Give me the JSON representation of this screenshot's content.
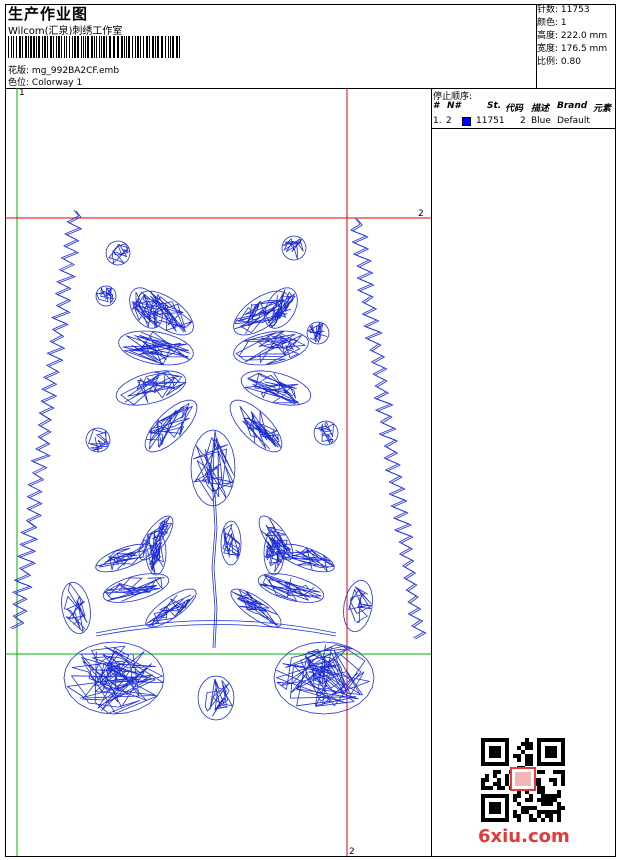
{
  "header": {
    "title": "生产作业图",
    "company": "Wilcom(汇泉)刺绣工作室",
    "design_label": "花版:",
    "design_value": "mg_992BA2CF.emb",
    "colorway_label": "色位:",
    "colorway_value": "Colorway 1"
  },
  "stats": [
    {
      "label": "针数:",
      "value": "11753"
    },
    {
      "label": "颜色:",
      "value": "1"
    },
    {
      "label": "高度:",
      "value": "222.0 mm"
    },
    {
      "label": "宽度:",
      "value": "176.5 mm"
    },
    {
      "label": "比例:",
      "value": "0.80"
    }
  ],
  "stop_sequence": {
    "title": "停止顺序:",
    "columns": [
      "#",
      "N#",
      "St.",
      "代码",
      "描述",
      "Brand",
      "元素"
    ],
    "rows": [
      {
        "index": "1.",
        "needle": "2",
        "stitches": "11751",
        "code": "2",
        "desc": "Blue",
        "brand": "Default",
        "color": "#0000ff"
      }
    ]
  },
  "guides": {
    "top_left": "1",
    "right_top": "2",
    "bottom_right": "2"
  },
  "watermark": "6xiu.com",
  "colors": {
    "thread": "#1f2fd8",
    "guide_red": "#e00000",
    "guide_green": "#00b000"
  }
}
